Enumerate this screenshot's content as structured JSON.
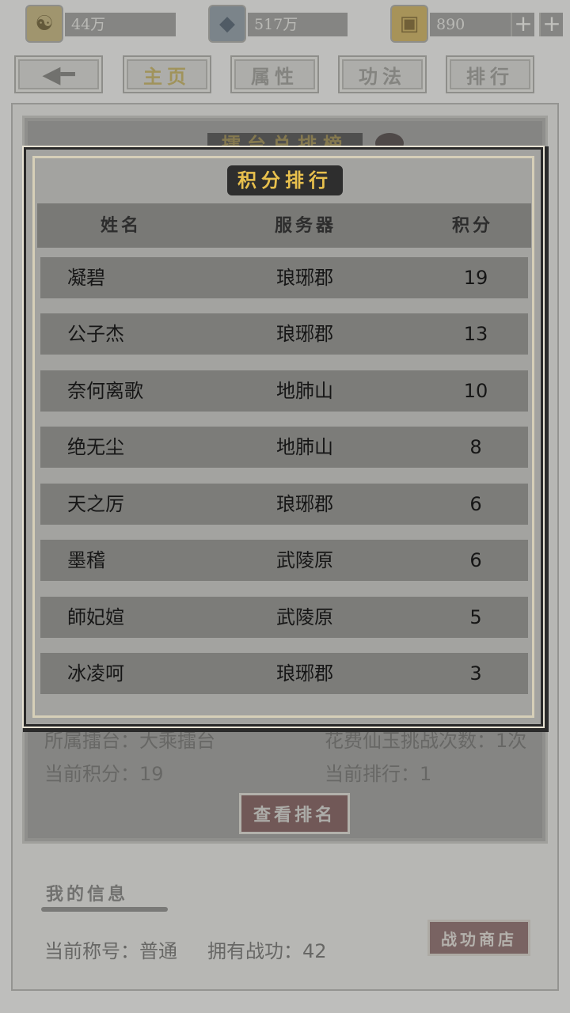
{
  "resources": [
    {
      "icon": "coin-icon",
      "glyph": "☯",
      "value": "44万",
      "has_plus": false
    },
    {
      "icon": "crystal-icon",
      "glyph": "◆",
      "value": "517万",
      "has_plus": true
    },
    {
      "icon": "jade-icon",
      "glyph": "▣",
      "value": "890",
      "has_plus": true
    }
  ],
  "nav": {
    "back_glyph": "◀━",
    "tabs": [
      "主页",
      "属性",
      "功法",
      "排行"
    ]
  },
  "arena": {
    "title": "擂台总排榜",
    "arena_label": "所属擂台：大乘擂台",
    "challenge_label": "花费仙玉挑战次数：1次",
    "score_label": "当前积分：19",
    "rank_label": "当前排行：1",
    "view_rank_button": "查看排名"
  },
  "my_info": {
    "title": "我的信息",
    "title_line": "当前称号：普通",
    "merit_line": "拥有战功：42",
    "shop_button": "战功商店"
  },
  "ranking": {
    "title": "积分排行",
    "headers": {
      "name": "姓名",
      "server": "服务器",
      "score": "积分"
    },
    "rows": [
      {
        "name": "凝碧",
        "server": "琅琊郡",
        "score": "19"
      },
      {
        "name": "公子杰",
        "server": "琅琊郡",
        "score": "13"
      },
      {
        "name": "奈何离歌",
        "server": "地肺山",
        "score": "10"
      },
      {
        "name": "绝无尘",
        "server": "地肺山",
        "score": "8"
      },
      {
        "name": "天之厉",
        "server": "琅琊郡",
        "score": "6"
      },
      {
        "name": "墨稽",
        "server": "武陵原",
        "score": "6"
      },
      {
        "name": "師妃媗",
        "server": "武陵原",
        "score": "5"
      },
      {
        "name": "冰凌呵",
        "server": "琅琊郡",
        "score": "3"
      }
    ]
  }
}
